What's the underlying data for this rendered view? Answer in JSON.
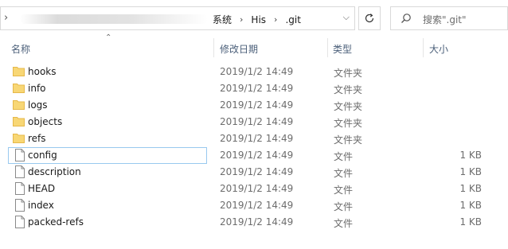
{
  "address": {
    "path": [
      "系统",
      "His",
      ".git"
    ]
  },
  "search": {
    "placeholder": "搜索\".git\""
  },
  "columns": {
    "name": "名称",
    "date": "修改日期",
    "type": "类型",
    "size": "大小"
  },
  "files": [
    {
      "name": "hooks",
      "date": "2019/1/2 14:49",
      "type": "文件夹",
      "size": "",
      "icon": "folder-icon"
    },
    {
      "name": "info",
      "date": "2019/1/2 14:49",
      "type": "文件夹",
      "size": "",
      "icon": "folder-icon"
    },
    {
      "name": "logs",
      "date": "2019/1/2 14:49",
      "type": "文件夹",
      "size": "",
      "icon": "folder-icon"
    },
    {
      "name": "objects",
      "date": "2019/1/2 14:49",
      "type": "文件夹",
      "size": "",
      "icon": "folder-icon"
    },
    {
      "name": "refs",
      "date": "2019/1/2 14:49",
      "type": "文件夹",
      "size": "",
      "icon": "folder-icon"
    },
    {
      "name": "config",
      "date": "2019/1/2 14:49",
      "type": "文件",
      "size": "1 KB",
      "icon": "file-icon"
    },
    {
      "name": "description",
      "date": "2019/1/2 14:49",
      "type": "文件",
      "size": "1 KB",
      "icon": "file-icon"
    },
    {
      "name": "HEAD",
      "date": "2019/1/2 14:49",
      "type": "文件",
      "size": "1 KB",
      "icon": "file-icon"
    },
    {
      "name": "index",
      "date": "2019/1/2 14:49",
      "type": "文件",
      "size": "1 KB",
      "icon": "file-icon"
    },
    {
      "name": "packed-refs",
      "date": "2019/1/2 14:49",
      "type": "文件",
      "size": "1 KB",
      "icon": "file-icon"
    }
  ],
  "colors": {
    "folder": "#f8d775",
    "folder_dark": "#e6b84a",
    "focus_border": "#99c9ef",
    "header_text": "#4c607a"
  }
}
